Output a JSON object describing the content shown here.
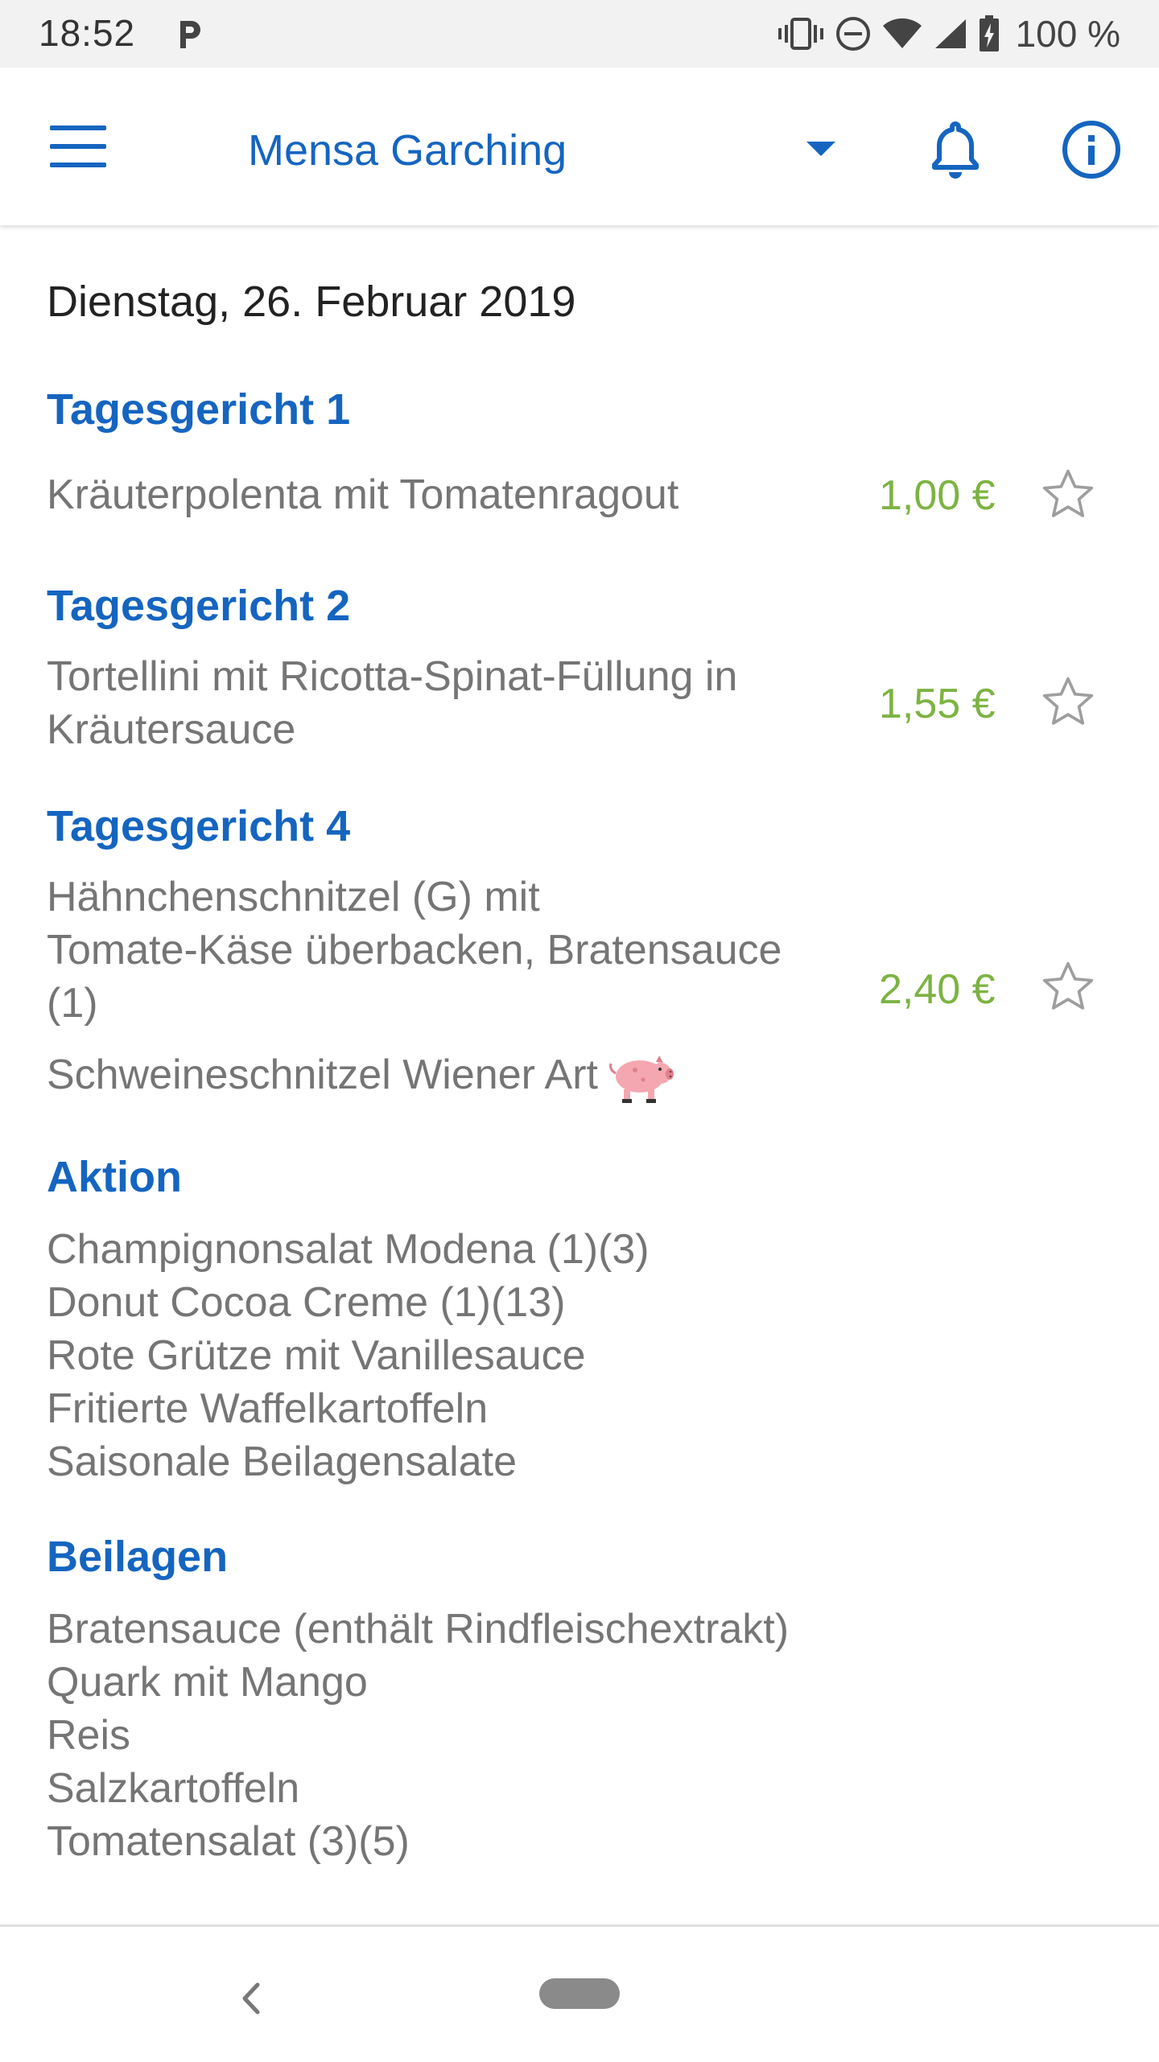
{
  "status_bar": {
    "time": "18:52",
    "battery": "100 %",
    "icons": [
      "parking-icon",
      "vibrate-icon",
      "dnd-icon",
      "wifi-icon",
      "signal-icon",
      "battery-charging-icon"
    ]
  },
  "app_bar": {
    "menu_icon": "hamburger-menu-icon",
    "cafeteria": "Mensa Garching",
    "dropdown_icon": "dropdown-arrow-icon",
    "notification_icon": "bell-icon",
    "info_icon": "info-icon"
  },
  "colors": {
    "primary": "#1565c0",
    "price": "#7cb342",
    "text_gray": "#757575"
  },
  "menu": {
    "date": "Dienstag, 26. Februar 2019",
    "dishes": [
      {
        "category": "Tagesgericht 1",
        "name": "Kräuterpolenta mit Tomatenragout",
        "price": "1,00 €"
      },
      {
        "category": "Tagesgericht 2",
        "name_line1": "Tortellini mit Ricotta-Spinat-Füllung in",
        "name_line2": "Kräutersauce",
        "price": "1,55 €"
      },
      {
        "category": "Tagesgericht 4",
        "name_line1": "Hähnchenschnitzel (G) mit",
        "name_line2": "Tomate-Käse überbacken, Bratensauce",
        "name_line3": "(1)",
        "price": "2,40 €",
        "extra": "Schweineschnitzel Wiener Art",
        "extra_icon": "pig-icon"
      }
    ],
    "aktion": {
      "title": "Aktion",
      "items": [
        "Champignonsalat Modena (1)(3)",
        "Donut Cocoa Creme (1)(13)",
        "Rote Grütze mit Vanillesauce",
        "Fritierte Waffelkartoffeln",
        "Saisonale Beilagensalate"
      ]
    },
    "beilagen": {
      "title": "Beilagen",
      "items": [
        "Bratensauce (enthält Rindfleischextrakt)",
        "Quark mit Mango",
        "Reis",
        "Salzkartoffeln",
        "Tomatensalat (3)(5)"
      ]
    }
  },
  "nav_bar": {
    "back_icon": "back-chevron-icon",
    "home_icon": "home-pill-icon"
  }
}
